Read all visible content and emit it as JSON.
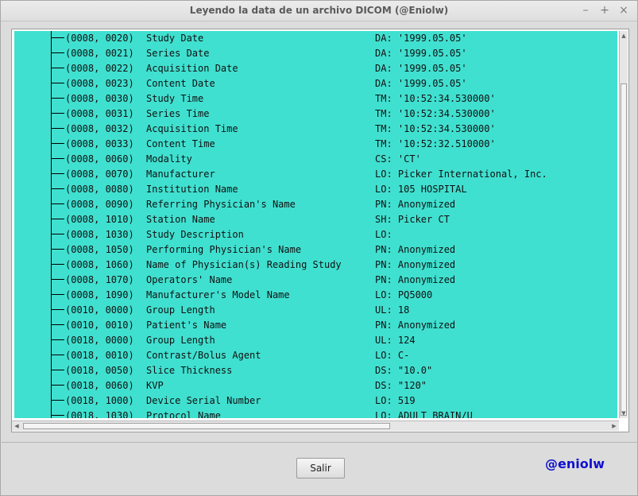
{
  "window": {
    "title": "Leyendo la data de un archivo DICOM (@Eniolw)",
    "controls": {
      "minimize": "–",
      "maximize": "+",
      "close": "×"
    }
  },
  "tree": {
    "background_color": "#40e0d0",
    "rows": [
      {
        "tag": "(0008, 0020)",
        "name": "Study Date",
        "value": "DA: '1999.05.05'"
      },
      {
        "tag": "(0008, 0021)",
        "name": "Series Date",
        "value": "DA: '1999.05.05'"
      },
      {
        "tag": "(0008, 0022)",
        "name": "Acquisition Date",
        "value": "DA: '1999.05.05'"
      },
      {
        "tag": "(0008, 0023)",
        "name": "Content Date",
        "value": "DA: '1999.05.05'"
      },
      {
        "tag": "(0008, 0030)",
        "name": "Study Time",
        "value": "TM: '10:52:34.530000'"
      },
      {
        "tag": "(0008, 0031)",
        "name": "Series Time",
        "value": "TM: '10:52:34.530000'"
      },
      {
        "tag": "(0008, 0032)",
        "name": "Acquisition Time",
        "value": "TM: '10:52:34.530000'"
      },
      {
        "tag": "(0008, 0033)",
        "name": "Content Time",
        "value": "TM: '10:52:32.510000'"
      },
      {
        "tag": "(0008, 0060)",
        "name": "Modality",
        "value": "CS: 'CT'"
      },
      {
        "tag": "(0008, 0070)",
        "name": "Manufacturer",
        "value": "LO: Picker International, Inc."
      },
      {
        "tag": "(0008, 0080)",
        "name": "Institution Name",
        "value": "LO: 105 HOSPITAL"
      },
      {
        "tag": "(0008, 0090)",
        "name": "Referring Physician's Name",
        "value": "PN: Anonymized"
      },
      {
        "tag": "(0008, 1010)",
        "name": "Station Name",
        "value": "SH: Picker CT"
      },
      {
        "tag": "(0008, 1030)",
        "name": "Study Description",
        "value": "LO:"
      },
      {
        "tag": "(0008, 1050)",
        "name": "Performing Physician's Name",
        "value": "PN: Anonymized"
      },
      {
        "tag": "(0008, 1060)",
        "name": "Name of Physician(s) Reading Study",
        "value": "PN: Anonymized"
      },
      {
        "tag": "(0008, 1070)",
        "name": "Operators' Name",
        "value": "PN: Anonymized"
      },
      {
        "tag": "(0008, 1090)",
        "name": "Manufacturer's Model Name",
        "value": "LO: PQ5000"
      },
      {
        "tag": "(0010, 0000)",
        "name": "Group Length",
        "value": "UL: 18"
      },
      {
        "tag": "(0010, 0010)",
        "name": "Patient's Name",
        "value": "PN: Anonymized"
      },
      {
        "tag": "(0018, 0000)",
        "name": "Group Length",
        "value": "UL: 124"
      },
      {
        "tag": "(0018, 0010)",
        "name": "Contrast/Bolus Agent",
        "value": "LO: C-"
      },
      {
        "tag": "(0018, 0050)",
        "name": "Slice Thickness",
        "value": "DS: \"10.0\""
      },
      {
        "tag": "(0018, 0060)",
        "name": "KVP",
        "value": "DS: \"120\""
      },
      {
        "tag": "(0018, 1000)",
        "name": "Device Serial Number",
        "value": "LO: 519"
      },
      {
        "tag": "(0018, 1030)",
        "name": "Protocol Name",
        "value": "LO: ADULT BRAIN/U"
      }
    ]
  },
  "footer": {
    "exit_button_label": "Salir",
    "brand": "@eniolw",
    "brand_color": "#1010d0"
  }
}
